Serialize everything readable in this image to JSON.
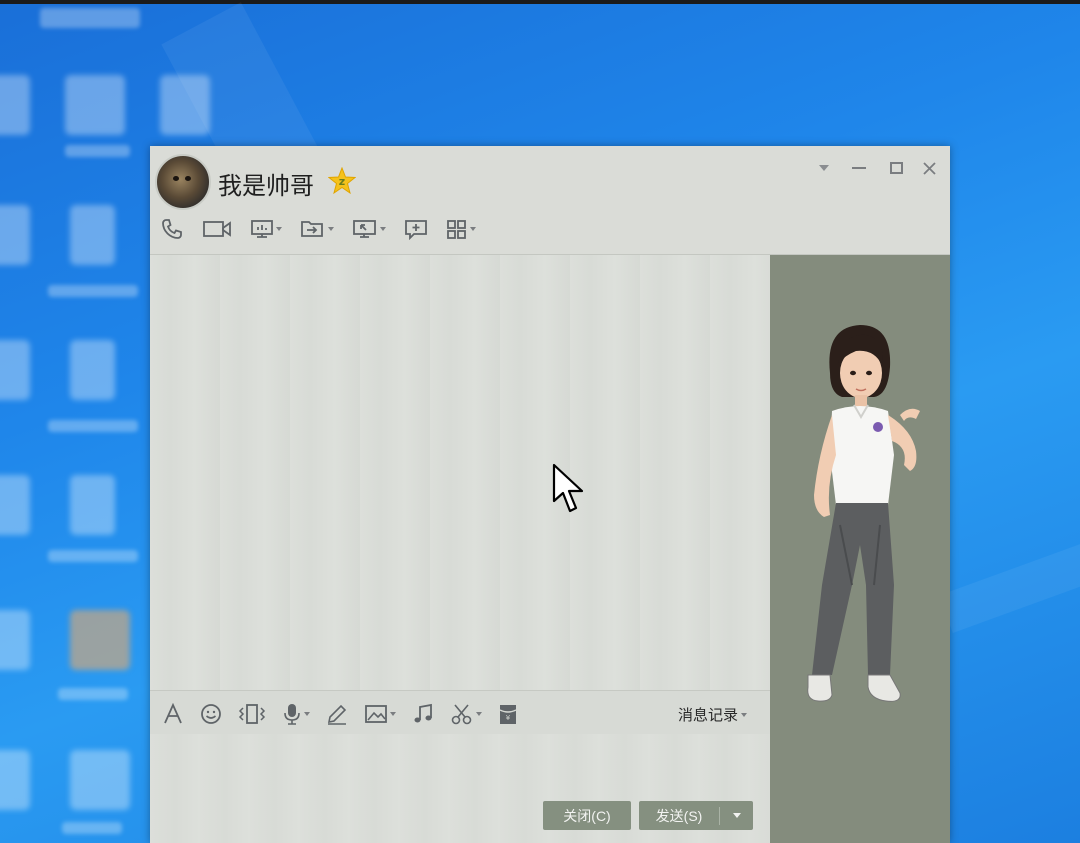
{
  "window": {
    "contact_name": "我是帅哥",
    "controls": [
      "chevron-down-icon",
      "minimize-icon",
      "maximize-icon",
      "close-icon"
    ]
  },
  "toolbar": {
    "items": [
      {
        "icon": "phone-icon",
        "dropdown": false
      },
      {
        "icon": "video-call-icon",
        "dropdown": false
      },
      {
        "icon": "screen-share-icon",
        "dropdown": true
      },
      {
        "icon": "file-transfer-icon",
        "dropdown": true
      },
      {
        "icon": "remote-assist-icon",
        "dropdown": true
      },
      {
        "icon": "add-message-icon",
        "dropdown": false
      },
      {
        "icon": "apps-grid-icon",
        "dropdown": true
      }
    ]
  },
  "input_toolbar": {
    "items": [
      {
        "icon": "font-icon"
      },
      {
        "icon": "emoji-icon"
      },
      {
        "icon": "vibrate-icon"
      },
      {
        "icon": "microphone-icon",
        "dropdown": true
      },
      {
        "icon": "pen-icon"
      },
      {
        "icon": "image-icon",
        "dropdown": true
      },
      {
        "icon": "music-icon"
      },
      {
        "icon": "scissors-icon",
        "dropdown": true
      },
      {
        "icon": "red-packet-icon"
      }
    ],
    "history_label": "消息记录"
  },
  "buttons": {
    "close_label": "关闭(C)",
    "send_label": "发送(S)"
  },
  "colors": {
    "window_bg": "#d7dad5",
    "side_panel": "#848c7d",
    "button_bg": "#859080",
    "desktop": "#1f86ea"
  }
}
